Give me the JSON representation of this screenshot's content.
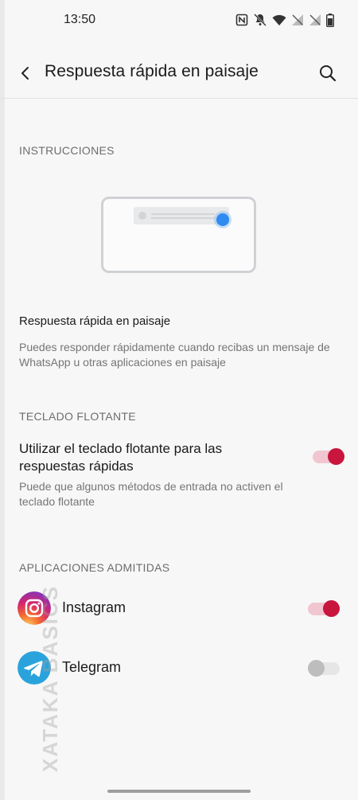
{
  "status_bar": {
    "time": "13:50"
  },
  "app_bar": {
    "title": "Respuesta rápida en paisaje"
  },
  "instructions": {
    "header": "INSTRUCCIONES",
    "item_title": "Respuesta rápida en paisaje",
    "description": "Puedes responder rápidamente cuando recibas un mensaje de WhatsApp u otras aplicaciones en paisaje"
  },
  "floating_keyboard": {
    "header": "TECLADO FLOTANTE",
    "title": "Utilizar el teclado flotante para las respuestas rápidas",
    "subtitle": "Puede que algunos métodos de entrada no activen el teclado flotante",
    "enabled": true
  },
  "supported_apps": {
    "header": "APLICACIONES ADMITIDAS",
    "apps": [
      {
        "name": "Instagram",
        "enabled": true
      },
      {
        "name": "Telegram",
        "enabled": false
      }
    ]
  },
  "watermark": {
    "text": "XATAKA BASICS"
  },
  "colors": {
    "accent": "#c8163c",
    "accent_track": "#f1c6d1",
    "telegram": "#2aa3dc"
  }
}
